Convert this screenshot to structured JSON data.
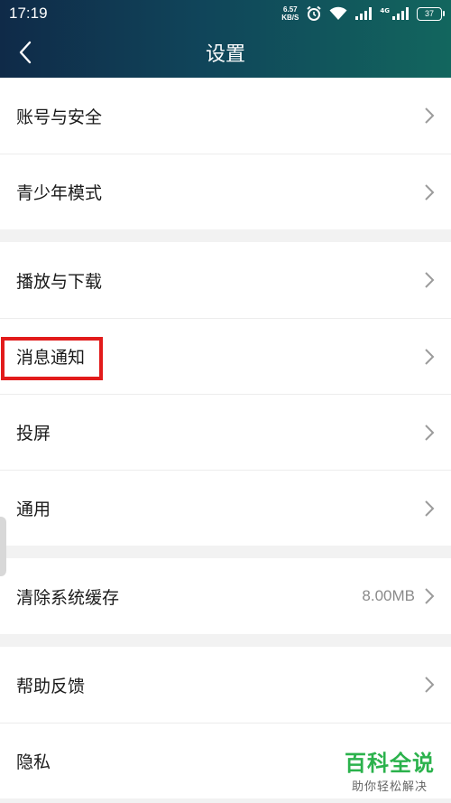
{
  "status": {
    "time": "17:19",
    "net_speed_value": "6.57",
    "net_speed_unit": "KB/S",
    "network_tag": "4G",
    "battery": "37",
    "icons": [
      "alarm-icon",
      "wifi-icon",
      "signal-icon",
      "signal-icon-2",
      "battery-icon"
    ]
  },
  "navbar": {
    "title": "设置",
    "back_icon": "back-arrow-icon"
  },
  "groups": {
    "g1": {
      "account": "账号与安全",
      "teen_mode": "青少年模式"
    },
    "g2": {
      "play_download": "播放与下载",
      "notifications": "消息通知",
      "cast": "投屏",
      "general": "通用"
    },
    "g3": {
      "clear_cache": "清除系统缓存",
      "cache_size": "8.00MB"
    },
    "g4": {
      "help_feedback": "帮助反馈",
      "privacy": "隐私"
    }
  },
  "highlighted_item": "消息通知",
  "watermark": {
    "main": "百科全说",
    "sub": "助你轻松解决"
  },
  "colors": {
    "header_start": "#0f2a48",
    "header_end": "#12665e",
    "highlight": "#e21b1b",
    "watermark": "#2bb24c"
  }
}
